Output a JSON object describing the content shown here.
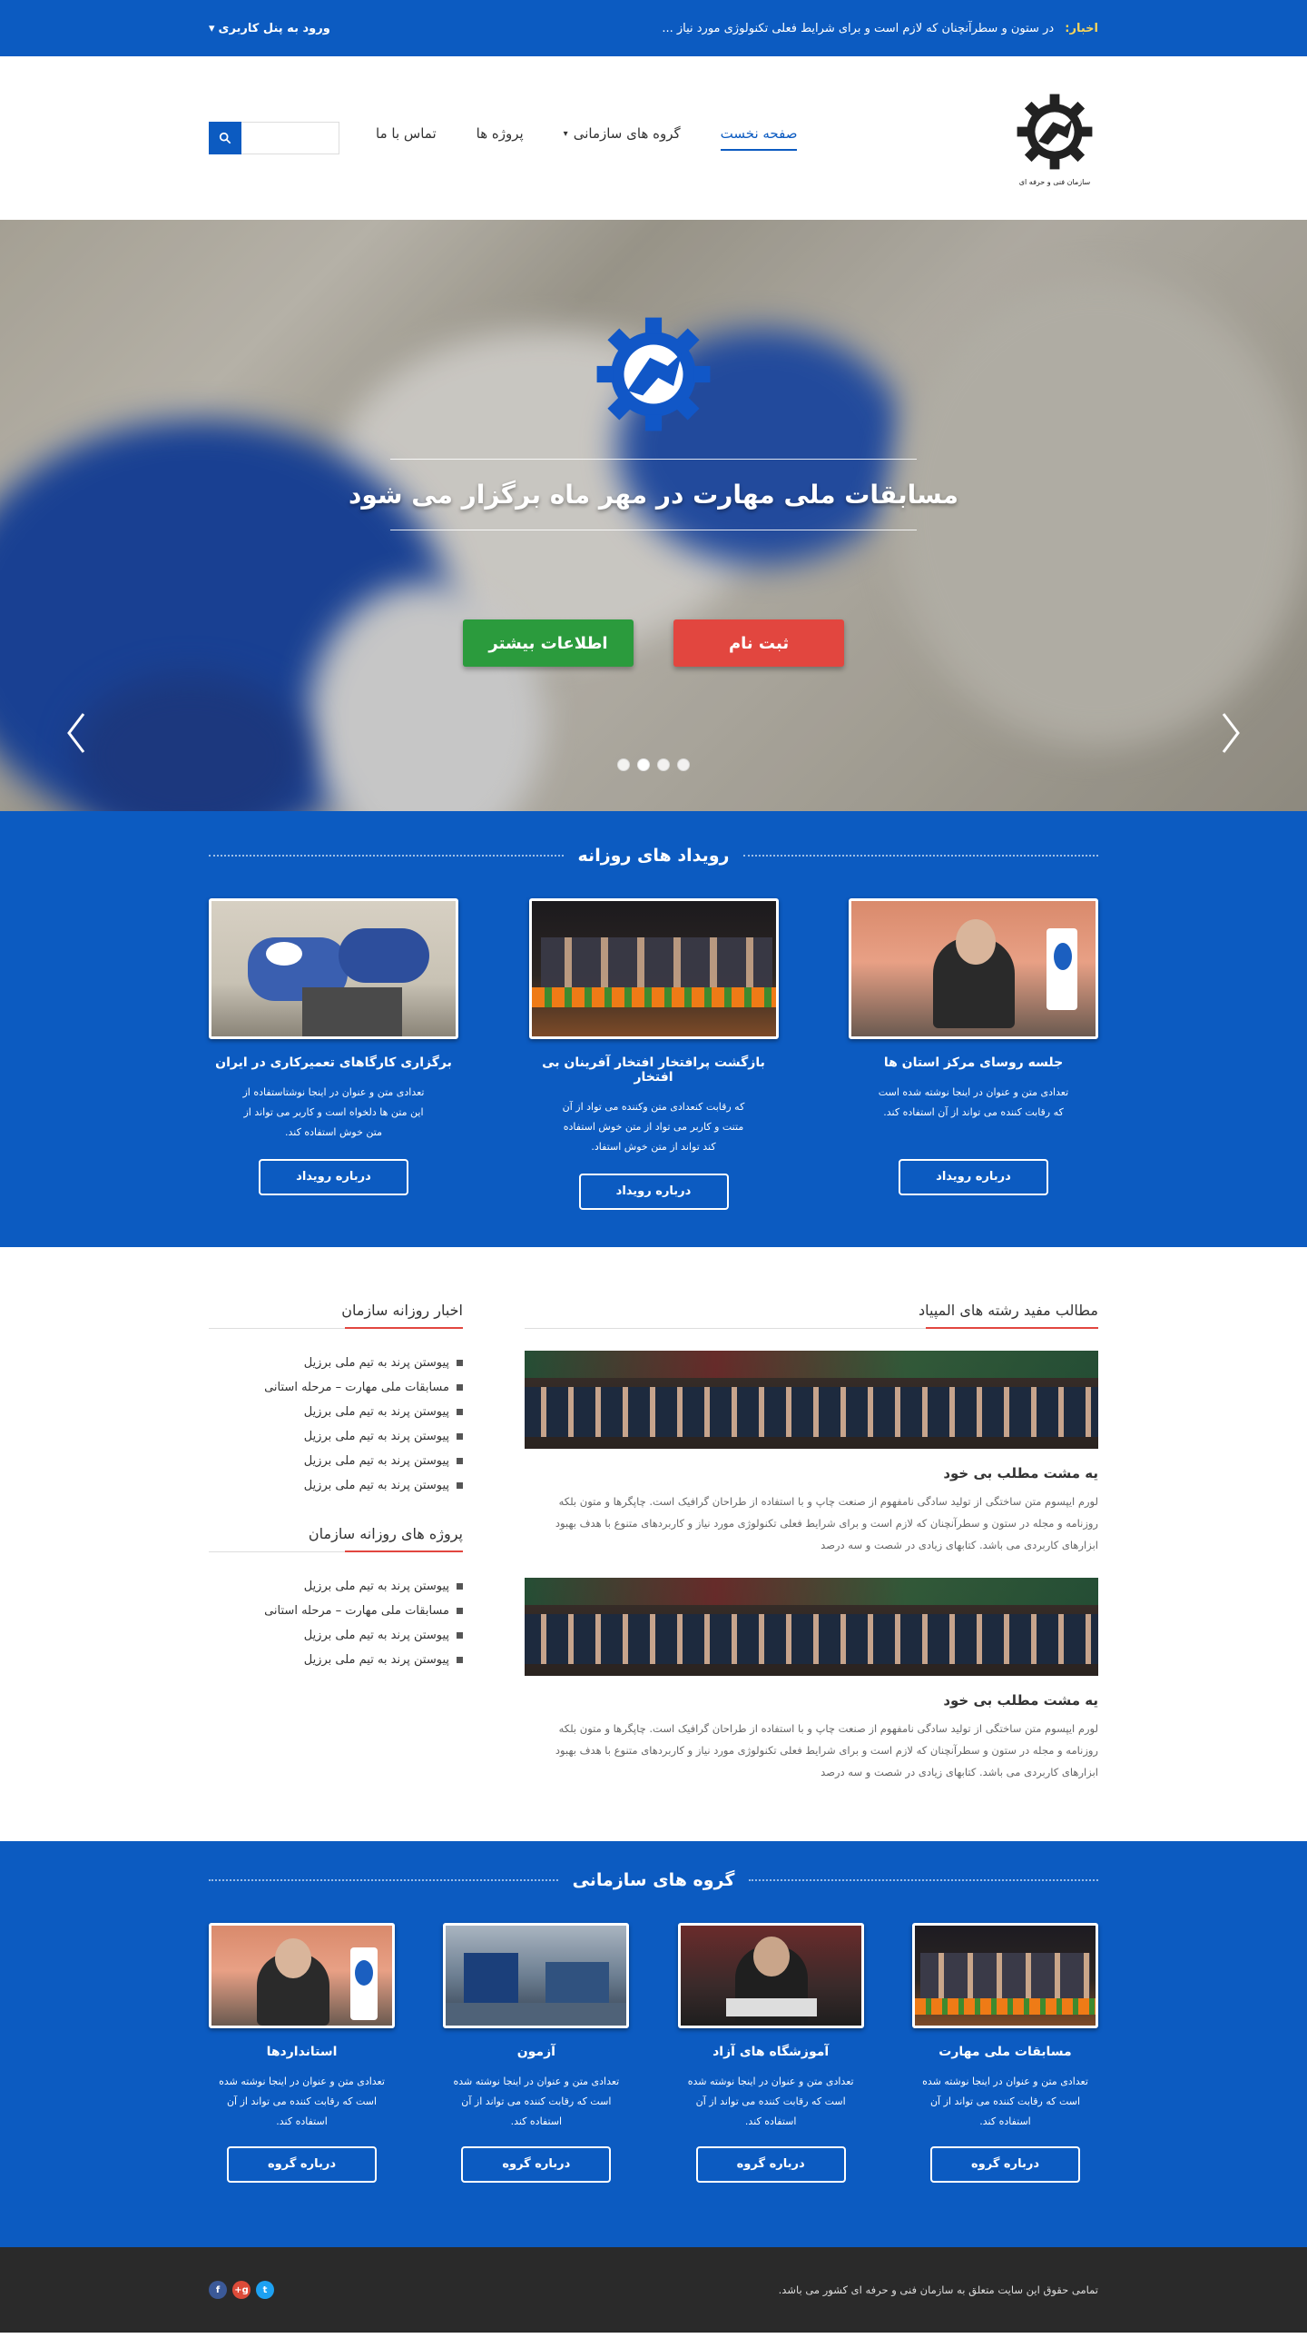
{
  "topbar": {
    "news_label": "اخبار:",
    "news_text": "در ستون و سطرآنچنان که لازم است و برای شرایط فعلی تکنولوژی مورد نیاز ...",
    "login_label": "ورود به پنل کاربری"
  },
  "header": {
    "logo_caption": "سازمان فنی و حرفه ای",
    "nav": [
      "صفحه نخست",
      "گروه های سازمانی",
      "پروژه ها",
      "تماس با ما"
    ],
    "search_placeholder": ""
  },
  "hero": {
    "title": "مسابقات ملی مهارت در مهر ماه برگزار می شود",
    "btn_register": "ثبت نام",
    "btn_more": "اطلاعات بیشتر",
    "slides": 4,
    "active_slide": 3
  },
  "events": {
    "title": "رویداد های روزانه",
    "items": [
      {
        "title": "جلسه روسای مرکز استان ها",
        "text": "تعدادی متن و عنوان در اینجا نوشته شده است که رقابت کننده می تواند از آن استفاده کند.",
        "button": "درباره رویداد"
      },
      {
        "title": "بازگشت پرافتخار افتخار آفرینان بی افتخار",
        "text": "که رقابت کنعدادی متن وکننده می تواد از آن متنت و کاربر می تواد از متن خوش استفاده کند  تواند از متن خوش استفاد.",
        "button": "درباره رویداد"
      },
      {
        "title": "برگزاری کارگاهای تعمیرکاری در ایران",
        "text": "تعدادی متن و عنوان در اینجا نوشتاستفاده از این متن ها دلخواه است و کاربر می تواند از متن خوش استفاده کند.",
        "button": "درباره رویداد"
      }
    ]
  },
  "content": {
    "main_title": "مطالب مفید رشته های المپیاد",
    "articles": [
      {
        "title": "یه مشت مطلب بی خود",
        "text": "لورم ایپسوم متن ساختگی از تولید سادگی نامفهوم از صنعت چاپ و با استفاده از طراحان گرافیک است. چاپگرها و متون بلکه روزنامه و مجله در ستون و سطرآنچنان که لازم است و برای شرایط فعلی تکنولوژی مورد نیاز و کاربردهای متنوع با هدف بهبود ابزارهای کاربردی می باشد. کتابهای زیادی در شصت و سه درصد"
      },
      {
        "title": "یه مشت مطلب بی خود",
        "text": "لورم ایپسوم متن ساختگی از تولید سادگی نامفهوم از صنعت چاپ و با استفاده از طراحان گرافیک است. چاپگرها و متون بلکه روزنامه و مجله در ستون و سطرآنچنان که لازم است و برای شرایط فعلی تکنولوژی مورد نیاز و کاربردهای متنوع با هدف بهبود ابزارهای کاربردی می باشد. کتابهای زیادی در شصت و سه درصد"
      }
    ],
    "side_news_title": "اخبار روزانه سازمان",
    "side_news": [
      "پیوستن پرند به تیم ملی برزیل",
      "مسابقات ملی مهارت – مرحله استانی",
      "پیوستن پرند به تیم ملی برزیل",
      "پیوستن پرند به تیم ملی برزیل",
      "پیوستن پرند به تیم ملی برزیل",
      "پیوستن پرند به تیم ملی برزیل"
    ],
    "side_projects_title": "پروژه های روزانه سازمان",
    "side_projects": [
      "پیوستن پرند به تیم ملی برزیل",
      "مسابقات ملی مهارت – مرحله استانی",
      "پیوستن پرند به تیم ملی برزیل",
      "پیوستن پرند به تیم ملی برزیل"
    ]
  },
  "groups": {
    "title": "گروه های سازمانی",
    "items": [
      {
        "title": "مسابقات ملی مهارت",
        "text": "تعدادی متن و عنوان در اینجا نوشته شده است که رقابت کننده می تواند از آن استفاده کند.",
        "button": "درباره گروه"
      },
      {
        "title": "آموزشگاه های آزاد",
        "text": "تعدادی متن و عنوان در اینجا نوشته شده است که رقابت کننده می تواند از آن استفاده کند.",
        "button": "درباره گروه"
      },
      {
        "title": "آزمون",
        "text": "تعدادی متن و عنوان در اینجا نوشته شده است که رقابت کننده می تواند از آن استفاده کند.",
        "button": "درباره گروه"
      },
      {
        "title": "استانداردها",
        "text": "تعدادی متن و عنوان در اینجا نوشته شده است که رقابت کننده می تواند از آن استفاده کند.",
        "button": "درباره گروه"
      }
    ]
  },
  "footer": {
    "copyright": "تمامی حقوق این سایت متعلق به سازمان فنی و حرفه ای کشور می باشد.",
    "socials": [
      "twitter-icon",
      "google-plus-icon",
      "facebook-icon"
    ]
  },
  "colors": {
    "primary": "#0c5bc1",
    "accent": "#e2463f",
    "green": "#2b9b3d",
    "footer": "#2a2a2a"
  }
}
